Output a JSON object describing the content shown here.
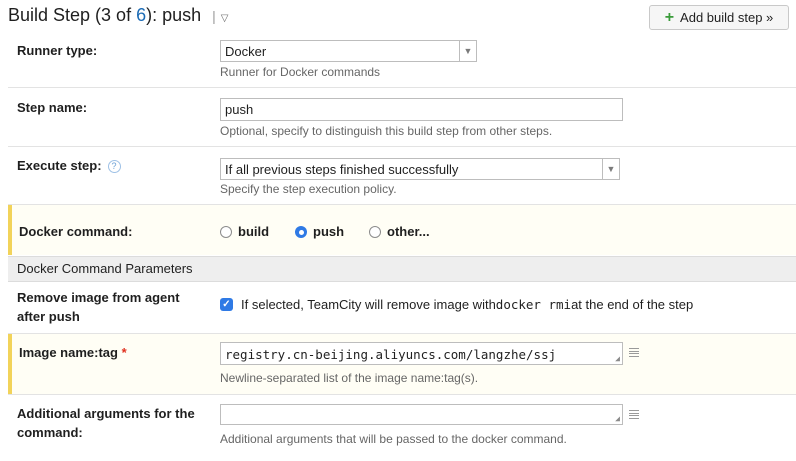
{
  "header": {
    "title_prefix": "Build Step (3 of ",
    "step_number": "6",
    "title_suffix": "): push",
    "separator": "|",
    "caret": "▽",
    "add_button": "Add build step »"
  },
  "runner_type": {
    "label": "Runner type:",
    "value": "Docker",
    "note": "Runner for Docker commands"
  },
  "step_name": {
    "label": "Step name:",
    "value": "push",
    "note": "Optional, specify to distinguish this build step from other steps."
  },
  "execute_step": {
    "label": "Execute step:",
    "value": "If all previous steps finished successfully",
    "note": "Specify the step execution policy."
  },
  "docker_command": {
    "label": "Docker command:",
    "options": [
      "build",
      "push",
      "other..."
    ],
    "selected": "push"
  },
  "section": {
    "title": "Docker Command Parameters"
  },
  "remove_image": {
    "label_line1": "Remove image from agent",
    "label_line2": "after push",
    "checked": true,
    "text_before": "If selected, TeamCity will remove image with ",
    "code": "docker rmi",
    "text_after": " at the end of the step"
  },
  "image_name": {
    "label": "Image name:tag",
    "required_mark": "*",
    "value": "registry.cn-beijing.aliyuncs.com/langzhe/ssj",
    "note": "Newline-separated list of the image name:tag(s)."
  },
  "additional_args": {
    "label_line1": "Additional arguments for the",
    "label_line2": "command:",
    "value": "",
    "note": "Additional arguments that will be passed to the docker command."
  },
  "colors": {
    "accent": "#2f7ae5",
    "link": "#1b6bb5",
    "highlight_bar": "#f2d35a",
    "required": "#e0301e"
  }
}
